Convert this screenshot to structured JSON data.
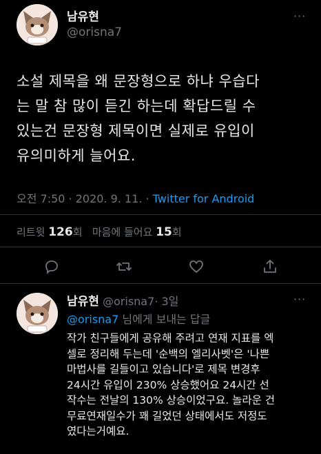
{
  "main_tweet": {
    "author_name": "남유현",
    "author_handle": "@orisna7",
    "text_lines": [
      "소설 제목을 왜 문장형으로 하냐 우습다",
      "는 말 참 많이 듣긴 하는데 확답드릴 수",
      "있는건 문장형 제목이면 실제로 유입이",
      "유의미하게 늘어요."
    ],
    "time": "오전 7:50 · 2020. 9. 11. · ",
    "source": "Twitter for Android",
    "retweet_label": "리트윗",
    "retweet_count": "126",
    "retweet_unit": "회",
    "like_label": "마음에 들어요",
    "like_count": "15",
    "like_unit": "회"
  },
  "reply_tweet": {
    "author_name": "남유현",
    "author_handle": "@orisna7",
    "age": "· 3일",
    "reply_to_handle": "@orisna7",
    "reply_to_suffix": " 님에게 보내는 답글",
    "text_lines": [
      "작가 친구들에게 공유해 주려고 연재 지표를 엑",
      "셀로 정리해 두는데 '순백의 엘리사벳'은 '나쁜",
      "마법사를 길들이고 있습니다'로 제목 변경후",
      "24시간 유입이 230% 상승했어요 24시간 선",
      "작수는 전날의 130% 상승이었구요. 놀라운 건",
      "무료연재일수가 꽤 길었던 상태에서도 저정도",
      "였다는거예요."
    ]
  },
  "more_glyph": "···",
  "icons": [
    "reply-icon",
    "retweet-icon",
    "like-icon",
    "share-icon",
    "more-icon",
    "avatar"
  ]
}
